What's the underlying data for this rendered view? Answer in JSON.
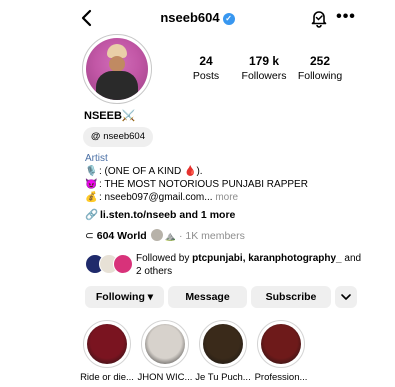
{
  "header": {
    "username": "nseeb604",
    "verified_icon": "verified-badge-icon",
    "more_label": "•••"
  },
  "stats": [
    {
      "value": "24",
      "label": "Posts"
    },
    {
      "value": "179 k",
      "label": "Followers"
    },
    {
      "value": "252",
      "label": "Following"
    }
  ],
  "profile": {
    "display_name": "NSEEB⚔️",
    "threads_handle": "nseeb604",
    "category": "Artist",
    "bio": [
      {
        "icon": "🎙️",
        "text": ": (ONE OF A KIND 🩸)."
      },
      {
        "icon": "😈",
        "text": ": THE MOST NOTORIOUS PUNJABI RAPPER"
      },
      {
        "icon": "💰",
        "text": ": nseeb097@gmail.com...",
        "more": " more"
      }
    ],
    "link": "li.sten.to/nseeb and 1 more",
    "channel": {
      "name": "604 World",
      "members": "· 1K members",
      "extra": "⛰️"
    }
  },
  "followed_by": {
    "prefix": "Followed by ",
    "names": "ptcpunjabi, karanphotography_",
    "suffix": " and 2 others",
    "avatar_colors": [
      "#1f2a6b",
      "#e7e1d6",
      "#d8327a"
    ]
  },
  "actions": {
    "following": "Following",
    "message": "Message",
    "subscribe": "Subscribe",
    "expand_icon": "chevron-down-icon"
  },
  "highlights": [
    {
      "label": "Ride or die...",
      "color": "#7a1420"
    },
    {
      "label": "JHON WIC...",
      "color": "#d7d2cc"
    },
    {
      "label": "Je Tu Puch...",
      "color": "#3a2a1a"
    },
    {
      "label": "Profession...",
      "color": "#6e1a1a"
    }
  ]
}
